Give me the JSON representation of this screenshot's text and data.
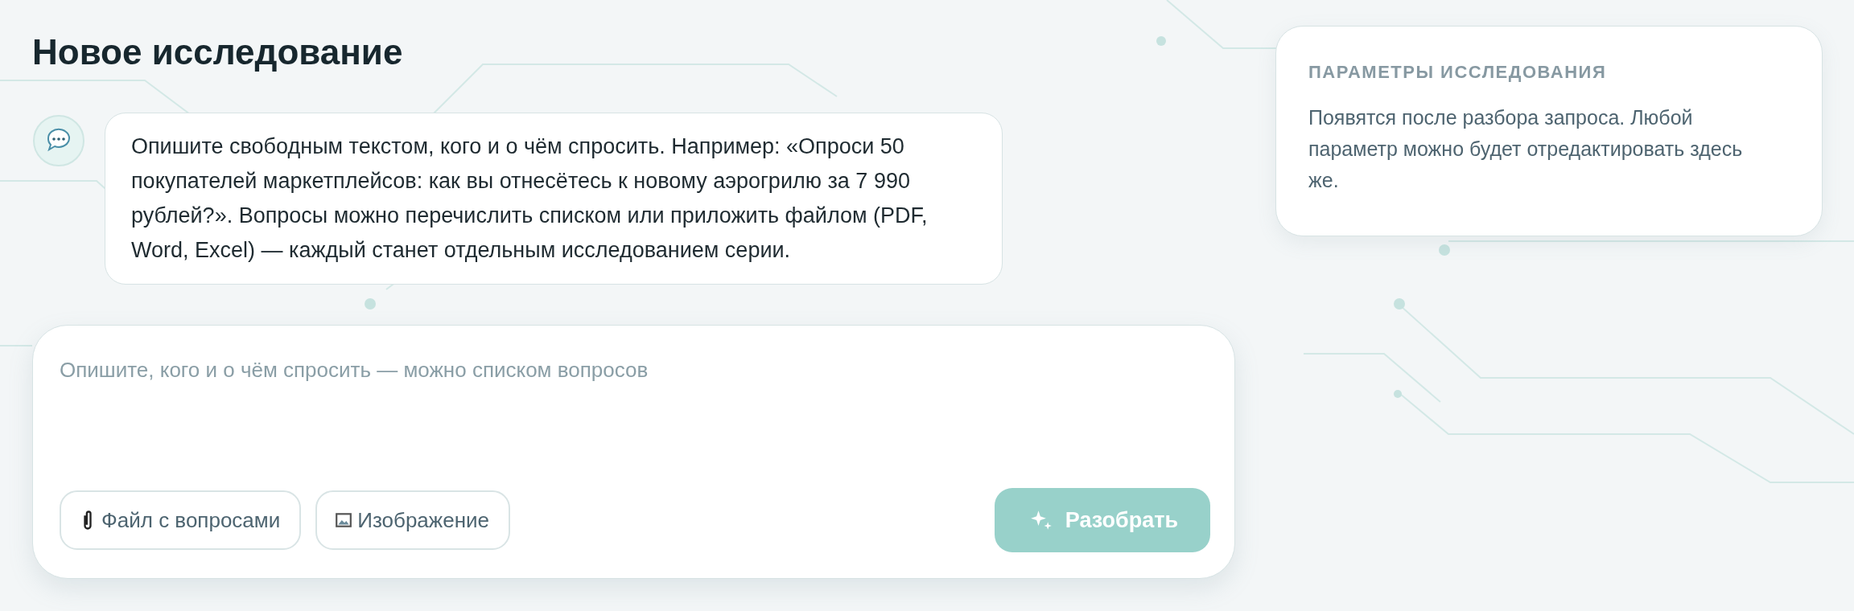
{
  "title": "Новое исследование",
  "assistant_message": "Опишите свободным текстом, кого и о чём спросить. Например: «Опроси 50 покупателей маркетплейсов: как вы отнесётесь к новому аэрогрилю за 7 990 рублей?». Вопросы можно перечислить списком или приложить файлом (PDF, Word, Excel) — каждый станет отдельным исследованием серии.",
  "composer": {
    "placeholder": "Опишите, кого и о чём спросить — можно списком вопросов",
    "attachments": [
      {
        "kind": "file",
        "label": "Файл с вопросами"
      },
      {
        "kind": "image",
        "label": "Изображение"
      }
    ],
    "submit": {
      "label": "Разобрать",
      "disabled": true
    }
  },
  "parameters_card": {
    "heading": "ПАРАМЕТРЫ ИССЛЕДОВАНИЯ",
    "text": "Появятся после разбора запроса. Любой параметр можно будет отредактировать здесь же."
  }
}
